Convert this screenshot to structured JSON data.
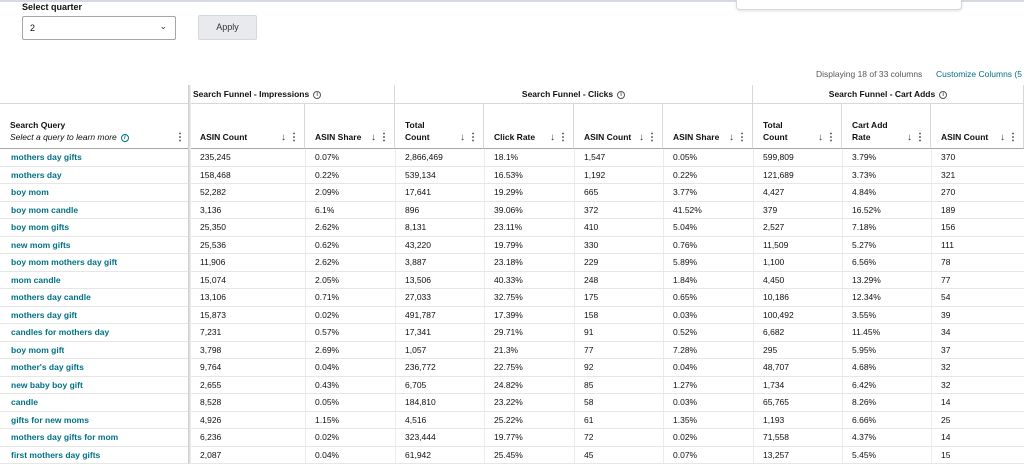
{
  "controls": {
    "quarter_label": "Select quarter",
    "quarter_value": "2",
    "apply_label": "Apply"
  },
  "display_info": "Displaying 18 of 33 columns",
  "customize_label": "Customize Columns (5",
  "query_header": {
    "title": "Search Query",
    "subtitle": "Select a query to learn more"
  },
  "groups": [
    {
      "label": "Search Funnel - Impressions"
    },
    {
      "label": "Search Funnel - Clicks"
    },
    {
      "label": "Search Funnel - Cart Adds"
    }
  ],
  "columns": [
    {
      "l1": "ASIN Count",
      "l2": ""
    },
    {
      "l1": "ASIN Share",
      "l2": ""
    },
    {
      "l1": "Total",
      "l2": "Count"
    },
    {
      "l1": "Click Rate",
      "l2": ""
    },
    {
      "l1": "ASIN Count",
      "l2": ""
    },
    {
      "l1": "ASIN Share",
      "l2": ""
    },
    {
      "l1": "Total",
      "l2": "Count"
    },
    {
      "l1": "Cart Add",
      "l2": "Rate"
    },
    {
      "l1": "ASIN Count",
      "l2": ""
    }
  ],
  "rows": [
    {
      "query": "mothers day gifts",
      "cells": [
        "235,245",
        "0.07%",
        "2,866,469",
        "18.1%",
        "1,547",
        "0.05%",
        "599,809",
        "3.79%",
        "370"
      ]
    },
    {
      "query": "mothers day",
      "cells": [
        "158,468",
        "0.22%",
        "539,134",
        "16.53%",
        "1,192",
        "0.22%",
        "121,689",
        "3.73%",
        "321"
      ]
    },
    {
      "query": "boy mom",
      "cells": [
        "52,282",
        "2.09%",
        "17,641",
        "19.29%",
        "665",
        "3.77%",
        "4,427",
        "4.84%",
        "270"
      ]
    },
    {
      "query": "boy mom candle",
      "cells": [
        "3,136",
        "6.1%",
        "896",
        "39.06%",
        "372",
        "41.52%",
        "379",
        "16.52%",
        "189"
      ]
    },
    {
      "query": "boy mom gifts",
      "cells": [
        "25,350",
        "2.62%",
        "8,131",
        "23.11%",
        "410",
        "5.04%",
        "2,527",
        "7.18%",
        "156"
      ]
    },
    {
      "query": "new mom gifts",
      "cells": [
        "25,536",
        "0.62%",
        "43,220",
        "19.79%",
        "330",
        "0.76%",
        "11,509",
        "5.27%",
        "111"
      ]
    },
    {
      "query": "boy mom mothers day gift",
      "cells": [
        "11,906",
        "2.62%",
        "3,887",
        "23.18%",
        "229",
        "5.89%",
        "1,100",
        "6.56%",
        "78"
      ]
    },
    {
      "query": "mom candle",
      "cells": [
        "15,074",
        "2.05%",
        "13,506",
        "40.33%",
        "248",
        "1.84%",
        "4,450",
        "13.29%",
        "77"
      ]
    },
    {
      "query": "mothers day candle",
      "cells": [
        "13,106",
        "0.71%",
        "27,033",
        "32.75%",
        "175",
        "0.65%",
        "10,186",
        "12.34%",
        "54"
      ]
    },
    {
      "query": "mothers day gift",
      "cells": [
        "15,873",
        "0.02%",
        "491,787",
        "17.39%",
        "158",
        "0.03%",
        "100,492",
        "3.55%",
        "39"
      ]
    },
    {
      "query": "candles for mothers day",
      "cells": [
        "7,231",
        "0.57%",
        "17,341",
        "29.71%",
        "91",
        "0.52%",
        "6,682",
        "11.45%",
        "34"
      ]
    },
    {
      "query": "boy mom gift",
      "cells": [
        "3,798",
        "2.69%",
        "1,057",
        "21.3%",
        "77",
        "7.28%",
        "295",
        "5.95%",
        "37"
      ]
    },
    {
      "query": "mother's day gifts",
      "cells": [
        "9,764",
        "0.04%",
        "236,772",
        "22.75%",
        "92",
        "0.04%",
        "48,707",
        "4.68%",
        "32"
      ]
    },
    {
      "query": "new baby boy gift",
      "cells": [
        "2,655",
        "0.43%",
        "6,705",
        "24.82%",
        "85",
        "1.27%",
        "1,734",
        "6.42%",
        "32"
      ]
    },
    {
      "query": "candle",
      "cells": [
        "8,528",
        "0.05%",
        "184,810",
        "23.22%",
        "58",
        "0.03%",
        "65,765",
        "8.26%",
        "14"
      ]
    },
    {
      "query": "gifts for new moms",
      "cells": [
        "4,926",
        "1.15%",
        "4,516",
        "25.22%",
        "61",
        "1.35%",
        "1,193",
        "6.66%",
        "25"
      ]
    },
    {
      "query": "mothers day gifts for mom",
      "cells": [
        "6,236",
        "0.02%",
        "323,444",
        "19.77%",
        "72",
        "0.02%",
        "71,558",
        "4.37%",
        "14"
      ]
    },
    {
      "query": "first mothers day gifts",
      "cells": [
        "2,087",
        "0.04%",
        "61,942",
        "25.45%",
        "45",
        "0.07%",
        "13,257",
        "5.45%",
        "15"
      ]
    }
  ]
}
